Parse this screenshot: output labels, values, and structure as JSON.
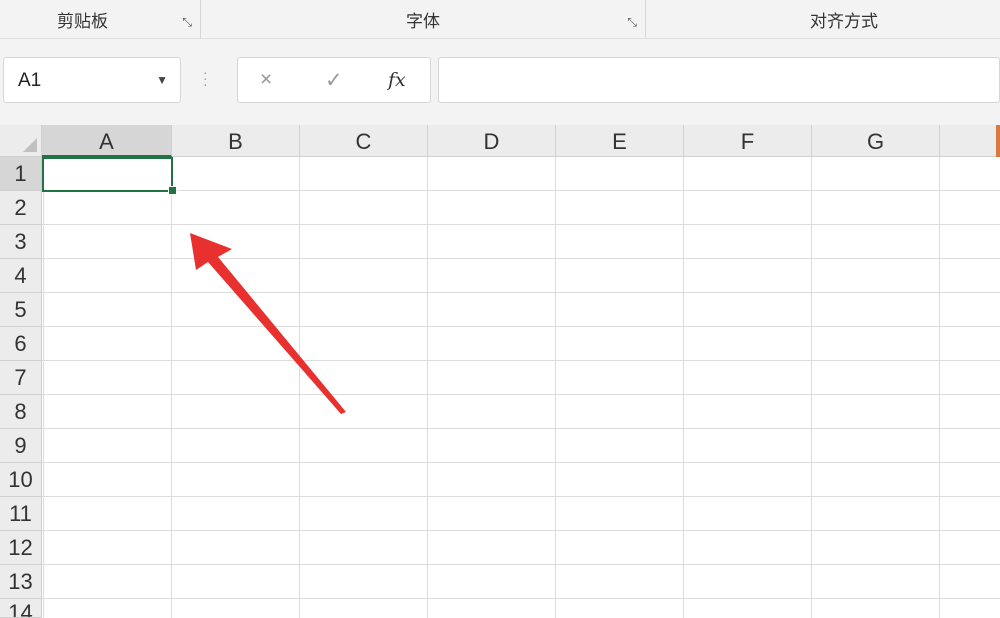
{
  "ribbon": {
    "groups": [
      {
        "label": "剪贴板"
      },
      {
        "label": "字体"
      },
      {
        "label": "对齐方式"
      }
    ]
  },
  "formula_bar": {
    "name_box_value": "A1",
    "cancel_glyph": "×",
    "confirm_glyph": "✓",
    "fx_label": "fx",
    "formula_value": ""
  },
  "grid": {
    "columns": [
      "A",
      "B",
      "C",
      "D",
      "E",
      "F",
      "G"
    ],
    "rows": [
      "1",
      "2",
      "3",
      "4",
      "5",
      "6",
      "7",
      "8",
      "9",
      "10",
      "11",
      "12",
      "13",
      "14"
    ],
    "active_cell": "A1"
  },
  "colors": {
    "selection": "#217346",
    "annotation_arrow": "#e8312f"
  }
}
